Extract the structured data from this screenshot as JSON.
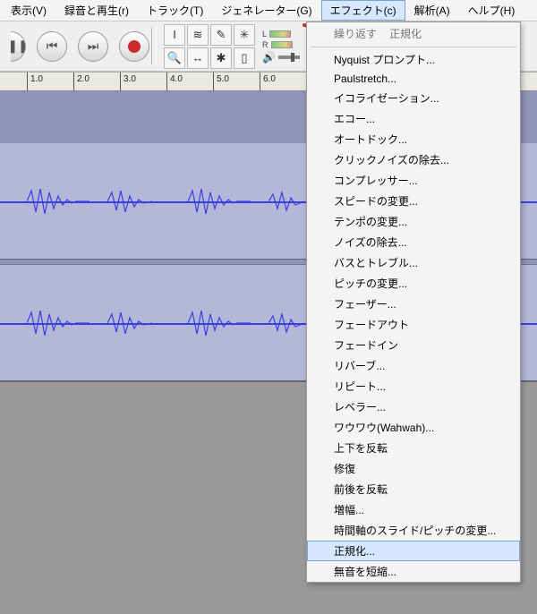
{
  "menubar": {
    "items": [
      {
        "label": "表示(V)",
        "name": "menu-view"
      },
      {
        "label": "録音と再生(r)",
        "name": "menu-record-play"
      },
      {
        "label": "トラック(T)",
        "name": "menu-track"
      },
      {
        "label": "ジェネレーター(G)",
        "name": "menu-generator"
      },
      {
        "label": "エフェクト(c)",
        "name": "menu-effect",
        "active": true
      },
      {
        "label": "解析(A)",
        "name": "menu-analyze"
      },
      {
        "label": "ヘルプ(H)",
        "name": "menu-help"
      }
    ]
  },
  "toolbar": {
    "tools": [
      "I",
      "≋",
      "✎",
      "✳",
      "🔍",
      "↔",
      "✱",
      "▯"
    ],
    "meter_left_label": "L",
    "meter_right_label": "R"
  },
  "ruler": {
    "ticks": [
      "1.0",
      "2.0",
      "3.0",
      "4.0",
      "5.0",
      "6.0"
    ]
  },
  "dropdown": {
    "top": {
      "repeat": "繰り返す",
      "normalize": "正規化"
    },
    "items": [
      "Nyquist プロンプト...",
      "Paulstretch...",
      "イコライゼーション...",
      "エコー...",
      "オートドック...",
      "クリックノイズの除去...",
      "コンプレッサー...",
      "スピードの変更...",
      "テンポの変更...",
      "ノイズの除去...",
      "バスとトレブル...",
      "ピッチの変更...",
      "フェーザー...",
      "フェードアウト",
      "フェードイン",
      "リバーブ...",
      "リピート...",
      "レベラー...",
      "ワウワウ(Wahwah)...",
      "上下を反転",
      "修復",
      "前後を反転",
      "増幅...",
      "時間軸のスライド/ピッチの変更...",
      "正規化...",
      "無音を短縮..."
    ],
    "highlight_index": 24
  }
}
